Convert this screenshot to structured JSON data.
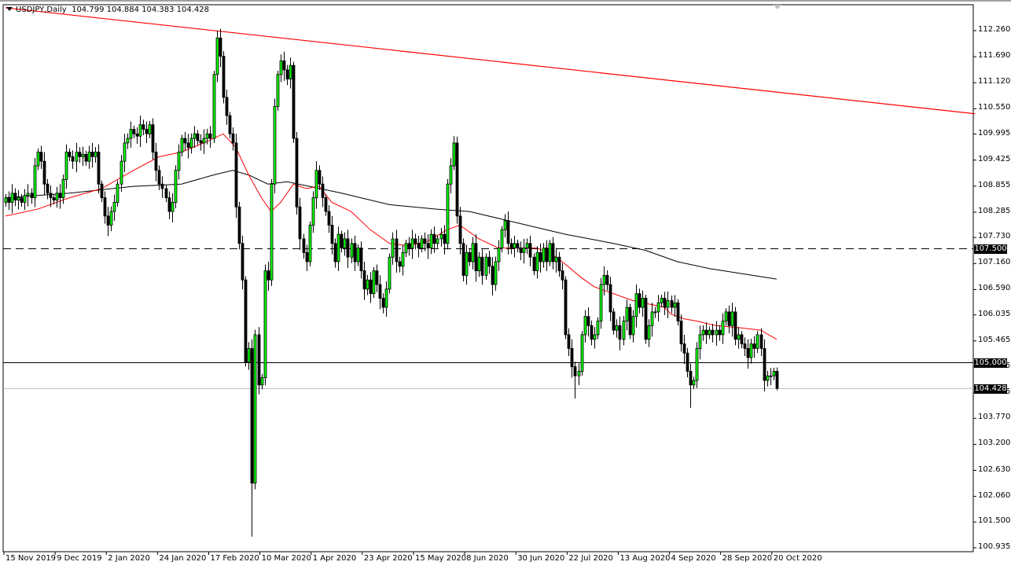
{
  "header": {
    "symbol_timeframe": "USDJPY,Daily",
    "ohlc_readout": "104.799 104.884 104.383 104.428"
  },
  "chart_data": {
    "type": "candlestick",
    "title": "USDJPY,Daily",
    "ylim": [
      100.935,
      112.26
    ],
    "colors": {
      "bull_body": "#00ff00",
      "bear_body": "#000000",
      "outline": "#000000",
      "ma_fast": "#ff0000",
      "ma_slow": "#000000",
      "trendline": "#ff0000",
      "bid_line": "#c0c0c0"
    },
    "closes": [
      108.6,
      108.5,
      108.7,
      108.55,
      108.6,
      108.5,
      108.65,
      108.7,
      108.6,
      109.3,
      109.6,
      109.4,
      108.9,
      108.7,
      108.6,
      108.55,
      108.7,
      108.6,
      109.0,
      109.6,
      109.5,
      109.4,
      109.6,
      109.5,
      109.55,
      109.4,
      109.6,
      109.5,
      109.6,
      108.9,
      108.6,
      108.2,
      108.0,
      108.3,
      108.5,
      108.9,
      109.4,
      109.8,
      109.9,
      110.1,
      110.0,
      109.95,
      110.2,
      110.1,
      110.0,
      110.2,
      109.6,
      109.2,
      108.9,
      108.8,
      108.6,
      108.3,
      108.5,
      109.2,
      109.6,
      109.9,
      109.8,
      109.7,
      109.9,
      110.0,
      109.85,
      109.8,
      109.9,
      110.0,
      109.9,
      111.3,
      112.1,
      111.7,
      110.8,
      110.4,
      110.0,
      109.8,
      108.4,
      107.6,
      106.8,
      105.0,
      105.3,
      102.35,
      105.6,
      104.5,
      104.66,
      107.0,
      106.8,
      108.9,
      110.6,
      111.3,
      111.6,
      111.4,
      111.2,
      111.5,
      109.9,
      108.4,
      107.7,
      107.4,
      107.2,
      108.0,
      108.6,
      109.2,
      108.9,
      108.6,
      108.3,
      108.0,
      107.6,
      107.2,
      107.8,
      107.5,
      107.7,
      107.3,
      107.6,
      107.2,
      107.5,
      107.0,
      106.6,
      106.8,
      106.5,
      107.0,
      106.7,
      106.4,
      106.2,
      106.6,
      107.3,
      107.7,
      107.2,
      107.1,
      107.4,
      107.6,
      107.5,
      107.7,
      107.6,
      107.5,
      107.7,
      107.6,
      107.5,
      107.8,
      107.6,
      107.7,
      107.8,
      107.6,
      108.9,
      109.3,
      109.8,
      108.2,
      107.6,
      106.9,
      107.4,
      107.2,
      107.6,
      107.0,
      107.3,
      106.9,
      107.3,
      107.1,
      106.7,
      107.2,
      107.5,
      107.9,
      108.1,
      107.6,
      107.5,
      107.6,
      107.5,
      107.4,
      107.5,
      107.6,
      107.3,
      107.0,
      107.4,
      107.2,
      107.5,
      107.2,
      107.6,
      107.2,
      107.3,
      107.0,
      106.8,
      105.6,
      105.3,
      104.9,
      104.7,
      104.8,
      105.6,
      106.0,
      105.8,
      105.5,
      105.6,
      105.9,
      106.7,
      106.9,
      106.7,
      106.1,
      105.7,
      105.8,
      105.5,
      105.9,
      106.2,
      105.6,
      106.0,
      106.5,
      106.2,
      106.4,
      105.5,
      105.8,
      106.1,
      106.1,
      106.3,
      106.4,
      106.2,
      106.35,
      106.2,
      106.3,
      105.9,
      105.4,
      105.2,
      104.8,
      104.5,
      104.6,
      105.3,
      105.6,
      105.7,
      105.6,
      105.7,
      105.6,
      105.7,
      105.6,
      105.9,
      106.1,
      105.8,
      106.1,
      105.5,
      105.6,
      105.4,
      105.3,
      105.1,
      105.4,
      105.3,
      105.6,
      105.3,
      104.6,
      104.7,
      104.7,
      104.799,
      104.428
    ],
    "last_bar": {
      "open": 104.799,
      "high": 104.884,
      "low": 104.383,
      "close": 104.428
    },
    "extremes": {
      "66": {
        "high": 112.26
      },
      "77": {
        "low": 101.18
      },
      "140": {
        "high": 109.95
      },
      "178": {
        "low": 104.2
      },
      "214": {
        "low": 104.0
      }
    },
    "ma_fast": [
      [
        0,
        108.2
      ],
      [
        10,
        108.35
      ],
      [
        20,
        108.6
      ],
      [
        30,
        108.8
      ],
      [
        40,
        109.2
      ],
      [
        48,
        109.5
      ],
      [
        55,
        109.6
      ],
      [
        62,
        109.8
      ],
      [
        68,
        110.0
      ],
      [
        72,
        109.7
      ],
      [
        76,
        109.1
      ],
      [
        80,
        108.6
      ],
      [
        83,
        108.3
      ],
      [
        86,
        108.5
      ],
      [
        90,
        108.9
      ],
      [
        94,
        108.8
      ],
      [
        98,
        108.85
      ],
      [
        102,
        108.5
      ],
      [
        108,
        108.3
      ],
      [
        114,
        107.9
      ],
      [
        120,
        107.6
      ],
      [
        126,
        107.55
      ],
      [
        132,
        107.65
      ],
      [
        138,
        107.9
      ],
      [
        142,
        108.0
      ],
      [
        148,
        107.7
      ],
      [
        154,
        107.5
      ],
      [
        160,
        107.5
      ],
      [
        166,
        107.5
      ],
      [
        170,
        107.4
      ],
      [
        174,
        107.2
      ],
      [
        180,
        106.85
      ],
      [
        184,
        106.65
      ],
      [
        188,
        106.55
      ],
      [
        196,
        106.35
      ],
      [
        206,
        106.2
      ],
      [
        208,
        106.05
      ],
      [
        212,
        105.95
      ],
      [
        216,
        105.9
      ],
      [
        222,
        105.8
      ],
      [
        230,
        105.75
      ],
      [
        236,
        105.7
      ],
      [
        241,
        105.5
      ]
    ],
    "ma_slow": [
      [
        0,
        108.6
      ],
      [
        20,
        108.7
      ],
      [
        40,
        108.85
      ],
      [
        55,
        108.9
      ],
      [
        65,
        109.1
      ],
      [
        71,
        109.2
      ],
      [
        76,
        109.1
      ],
      [
        82,
        108.9
      ],
      [
        88,
        108.95
      ],
      [
        95,
        108.85
      ],
      [
        105,
        108.7
      ],
      [
        120,
        108.45
      ],
      [
        135,
        108.35
      ],
      [
        145,
        108.3
      ],
      [
        160,
        108.05
      ],
      [
        175,
        107.8
      ],
      [
        190,
        107.6
      ],
      [
        200,
        107.45
      ],
      [
        210,
        107.2
      ],
      [
        220,
        107.05
      ],
      [
        241,
        106.82
      ]
    ],
    "trendline": {
      "from": [
        0,
        112.76
      ],
      "to": [
        303,
        110.44
      ]
    },
    "horizontal_lines": [
      {
        "name": "resistance-107-5",
        "price": 107.5,
        "style": "dashed",
        "label": "107.500"
      },
      {
        "name": "support-105",
        "price": 105.0,
        "style": "solid",
        "label": "105.000"
      },
      {
        "name": "bid-line",
        "price": 104.428,
        "style": "bid",
        "label": "104.428"
      }
    ],
    "y_ticks": [
      "112.260",
      "111.690",
      "111.120",
      "110.550",
      "109.995",
      "109.425",
      "108.855",
      "108.285",
      "107.730",
      "107.160",
      "106.590",
      "106.035",
      "105.465",
      "104.895",
      "104.325",
      "103.770",
      "103.200",
      "102.630",
      "102.060",
      "101.500",
      "100.935"
    ],
    "x_ticks": [
      {
        "bar": 0,
        "label": "15 Nov 2019"
      },
      {
        "bar": 16,
        "label": "9 Dec 2019"
      },
      {
        "bar": 32,
        "label": "2 Jan 2020"
      },
      {
        "bar": 48,
        "label": "24 Jan 2020"
      },
      {
        "bar": 64,
        "label": "17 Feb 2020"
      },
      {
        "bar": 80,
        "label": "10 Mar 2020"
      },
      {
        "bar": 96,
        "label": "1 Apr 2020"
      },
      {
        "bar": 112,
        "label": "23 Apr 2020"
      },
      {
        "bar": 128,
        "label": "15 May 2020"
      },
      {
        "bar": 144,
        "label": "8 Jun 2020"
      },
      {
        "bar": 160,
        "label": "30 Jun 2020"
      },
      {
        "bar": 176,
        "label": "22 Jul 2020"
      },
      {
        "bar": 192,
        "label": "13 Aug 2020"
      },
      {
        "bar": 208,
        "label": "4 Sep 2020"
      },
      {
        "bar": 224,
        "label": "28 Sep 2020"
      },
      {
        "bar": 240,
        "label": "20 Oct 2020"
      }
    ]
  }
}
